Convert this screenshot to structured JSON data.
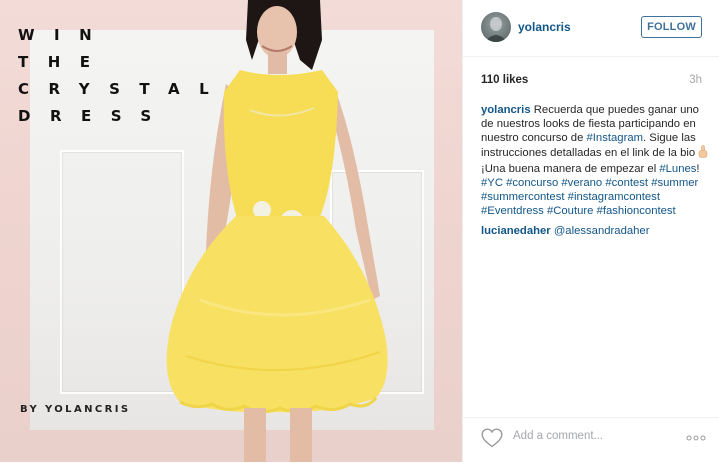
{
  "colors": {
    "link": "#125688",
    "follow_border": "#3f729b",
    "muted": "#a5a7aa",
    "dress_yellow": "#f6dd55",
    "background_pink": "#efd4cf"
  },
  "image": {
    "title_lines": [
      "WIN",
      "THE",
      "CRYSTAL",
      "DRESS"
    ],
    "byline": "BY YOLANCRIS"
  },
  "header": {
    "username": "yolancris",
    "follow_label": "FOLLOW",
    "avatar_icon": "profile-avatar"
  },
  "meta": {
    "likes": "110 likes",
    "time": "3h"
  },
  "caption": {
    "author": "yolancris",
    "text_1": " Recuerda que puedes ganar uno de nuestros looks de fiesta participando en nuestro concurso de ",
    "tag_instagram": "#Instagram",
    "text_2": ". Sigue las instrucciones detalladas en el link de la bio ",
    "emoji_icon": "pointing-up-hand-icon",
    "text_3": "¡Una buena manera de empezar el ",
    "tag_lunes": "#Lunes",
    "text_4": "!",
    "hashtags": [
      "#YC",
      "#concurso",
      "#verano",
      "#contest",
      "#summer",
      "#summercontest",
      "#instagramcontest",
      "#Eventdress",
      "#Couture",
      "#fashioncontest"
    ]
  },
  "comment": {
    "author": "lucianedaher",
    "text": "@alessandradaher"
  },
  "footer": {
    "add_comment_placeholder": "Add a comment...",
    "heart_icon": "heart-icon",
    "more_icon": "more-options-icon"
  }
}
